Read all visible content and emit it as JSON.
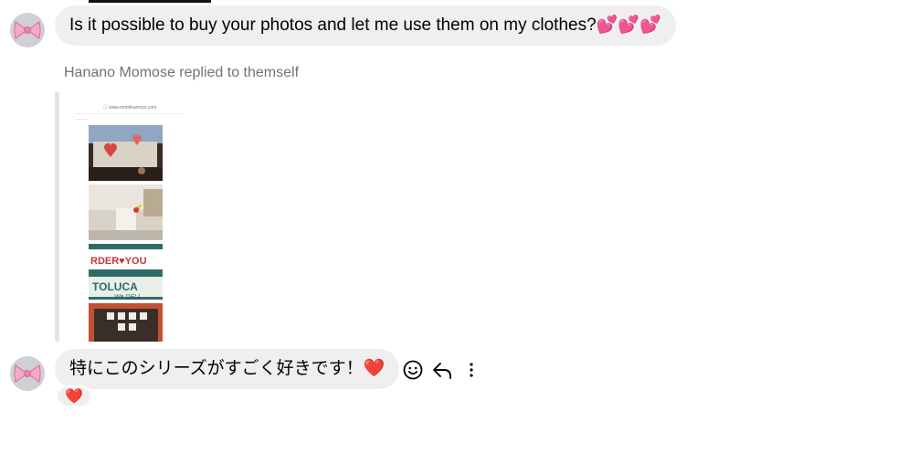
{
  "messages": [
    {
      "text": "Is it possible to buy your photos and let me use them on my clothes?",
      "emoji": "💕💕💕"
    },
    {
      "text": "特にこのシリーズがすごく好きです！",
      "emoji": "❤️"
    }
  ],
  "reply": {
    "label": "Hanano Momose replied to themself",
    "card_url": "ⓘ www.momikamoys.com",
    "card_tag": "———"
  },
  "reaction": {
    "emoji": "❤️"
  },
  "icons": {
    "avatar": "bow-avatar-icon",
    "emoji_action": "smiley-icon",
    "reply_action": "reply-arrow-icon",
    "more_action": "more-vertical-icon"
  },
  "colors": {
    "bubble": "#efefef",
    "secondary_text": "#737373",
    "heart": "#e0245e",
    "reply_bar": "#e3e3e3"
  }
}
